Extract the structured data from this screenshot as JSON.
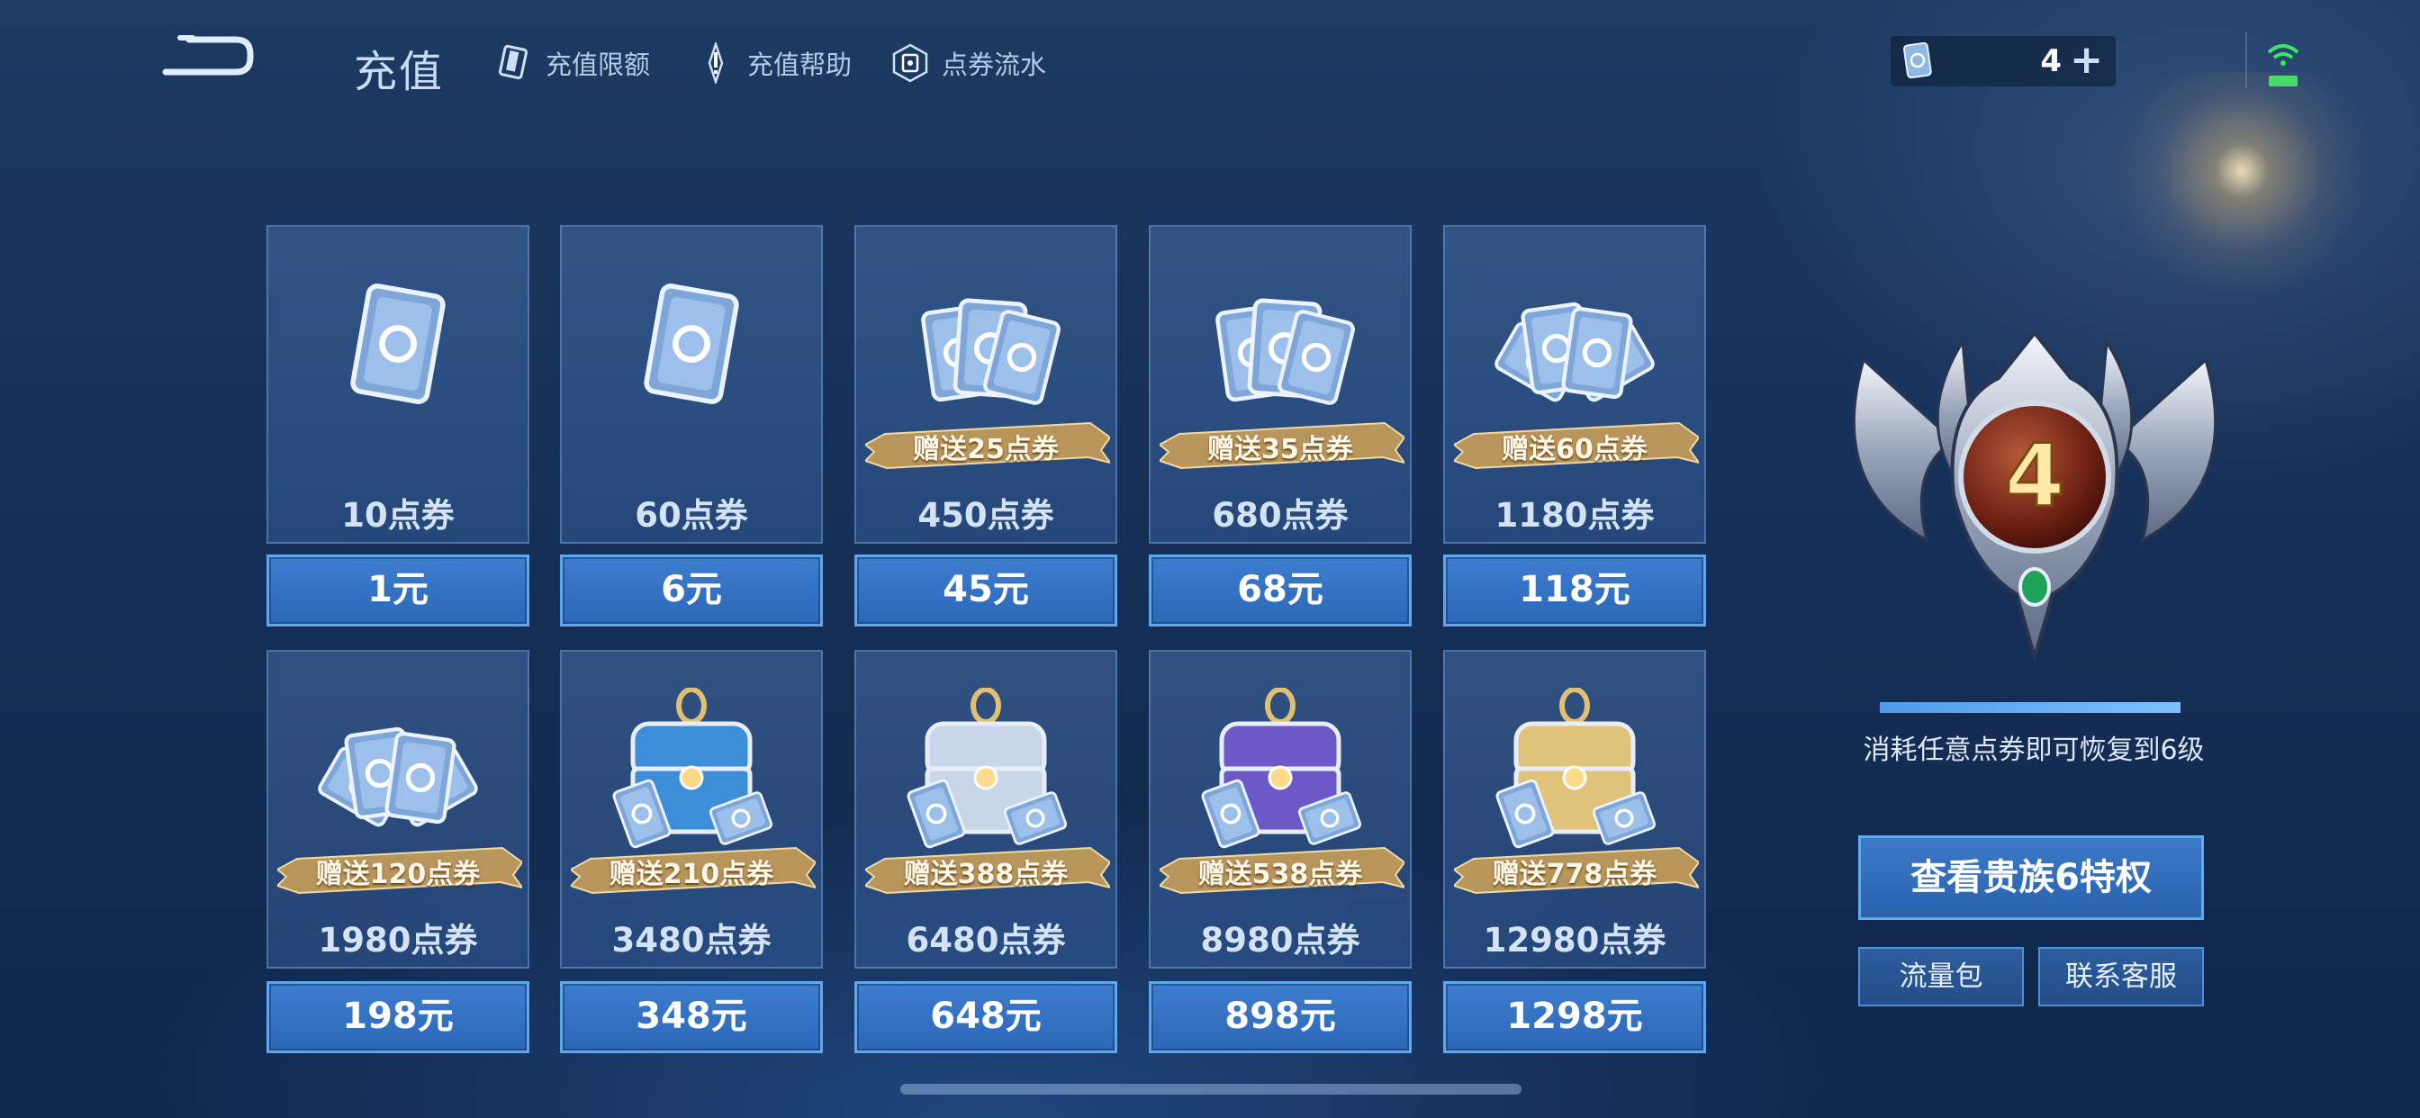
{
  "header": {
    "title": "充值",
    "nav": [
      {
        "label": "充值限额",
        "icon": "card-icon"
      },
      {
        "label": "充值帮助",
        "icon": "exclamation-icon"
      },
      {
        "label": "点券流水",
        "icon": "ticket-flow-icon"
      }
    ],
    "coupon_balance": "4",
    "plus_label": "+"
  },
  "colors": {
    "accent": "#3d7dcf",
    "ribbon": "#b8955a",
    "background": "#163159"
  },
  "packages": [
    {
      "amount": "10点券",
      "price": "1元",
      "bonus": "",
      "art": "single-coupon"
    },
    {
      "amount": "60点券",
      "price": "6元",
      "bonus": "",
      "art": "single-coupon"
    },
    {
      "amount": "450点券",
      "price": "45元",
      "bonus": "赠送25点券",
      "art": "coupon-fan"
    },
    {
      "amount": "680点券",
      "price": "68元",
      "bonus": "赠送35点券",
      "art": "coupon-fan"
    },
    {
      "amount": "1180点券",
      "price": "118元",
      "bonus": "赠送60点券",
      "art": "coupon-pile"
    },
    {
      "amount": "1980点券",
      "price": "198元",
      "bonus": "赠送120点券",
      "art": "coupon-pile"
    },
    {
      "amount": "3480点券",
      "price": "348元",
      "bonus": "赠送210点券",
      "art": "chest-blue"
    },
    {
      "amount": "6480点券",
      "price": "648元",
      "bonus": "赠送388点券",
      "art": "chest-silver"
    },
    {
      "amount": "8980点券",
      "price": "898元",
      "bonus": "赠送538点券",
      "art": "chest-purple"
    },
    {
      "amount": "12980点券",
      "price": "1298元",
      "bonus": "赠送778点券",
      "art": "chest-gold"
    }
  ],
  "vip": {
    "level": "4",
    "progress": 1.0,
    "restore_text": "消耗任意点券即可恢复到6级",
    "view_button": "查看贵族6特权",
    "traffic_button": "流量包",
    "service_button": "联系客服"
  }
}
